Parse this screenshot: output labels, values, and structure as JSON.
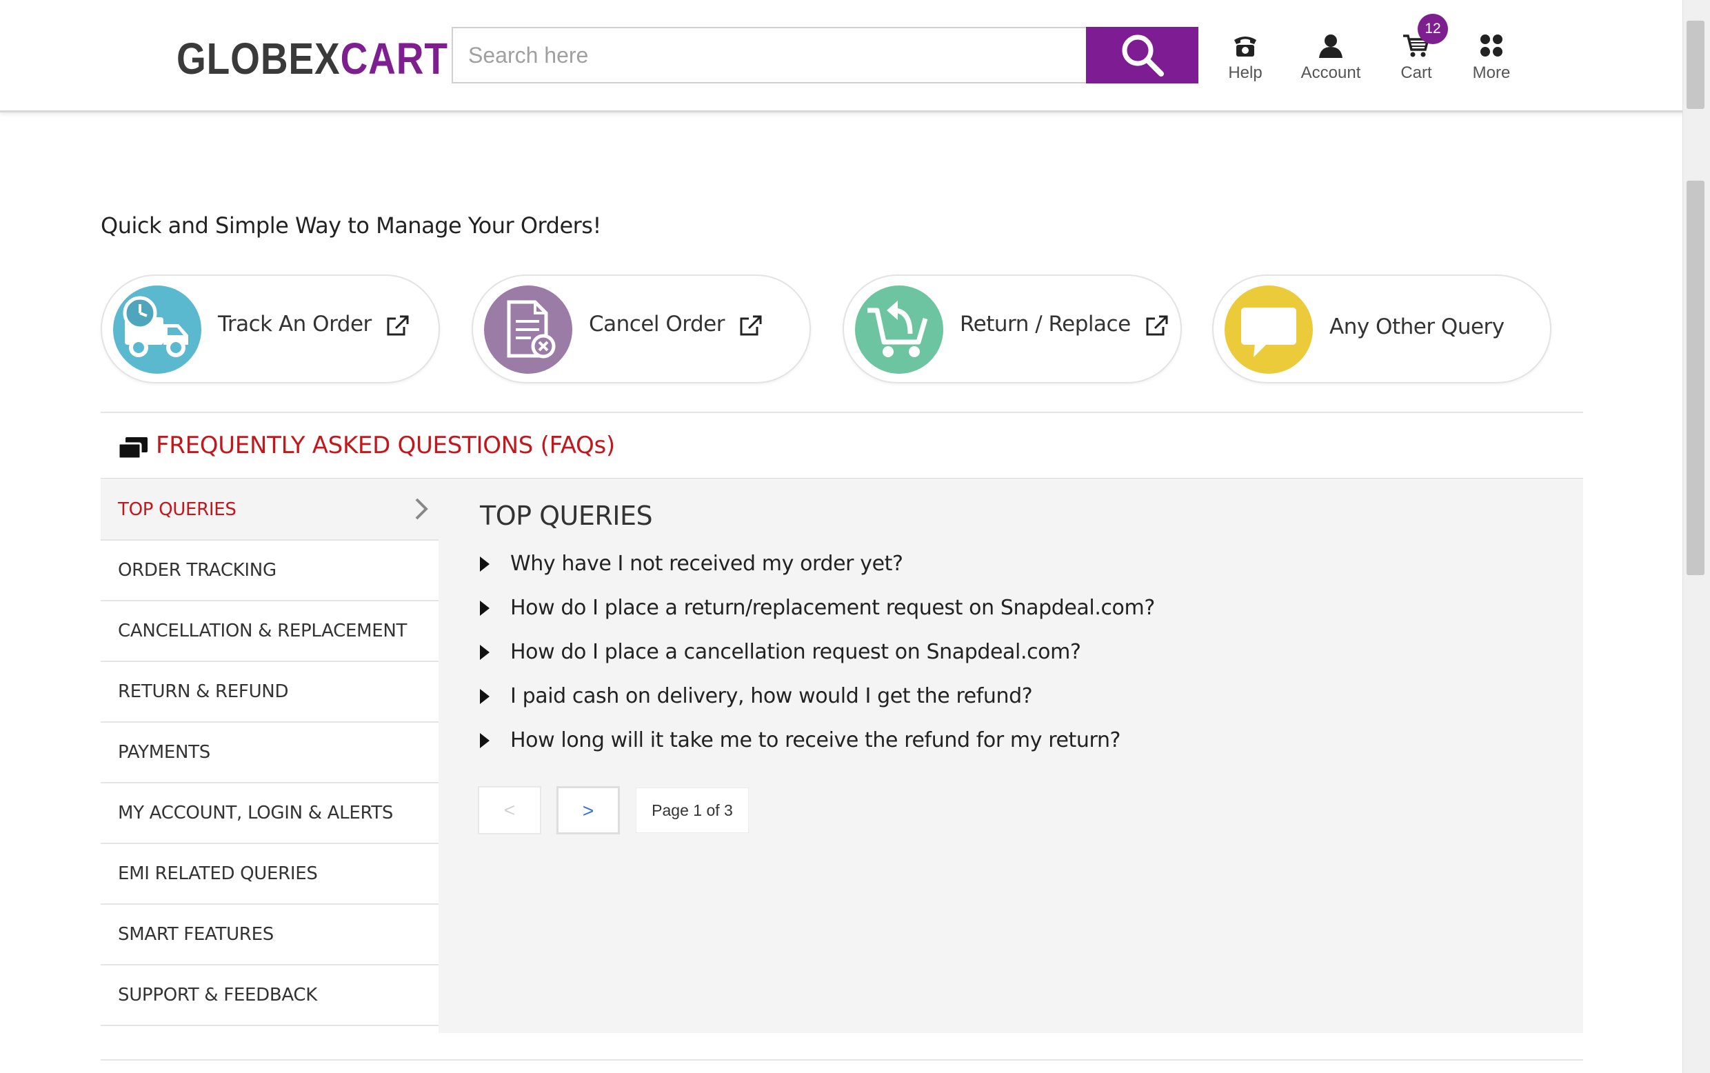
{
  "header": {
    "logo_part1": "GLOBEX",
    "logo_part2": "CART",
    "search_placeholder": "Search here",
    "nav": {
      "help": "Help",
      "account": "Account",
      "cart": "Cart",
      "cart_count": "12",
      "more": "More"
    }
  },
  "main": {
    "tagline": "Quick and Simple Way to Manage Your Orders!",
    "cards": [
      {
        "label": "Track An Order",
        "icon": "truck-clock-icon",
        "color": "#5bb9cf"
      },
      {
        "label": "Cancel Order",
        "icon": "document-cancel-icon",
        "color": "#9b7ca6"
      },
      {
        "label": "Return / Replace",
        "icon": "cart-return-icon",
        "color": "#6cc4a0"
      },
      {
        "label": "Any Other Query",
        "icon": "speech-bubble-icon",
        "color": "#eccb3a"
      }
    ]
  },
  "faq": {
    "title": "FREQUENTLY ASKED QUESTIONS (FAQs)",
    "categories": [
      "TOP QUERIES",
      "ORDER TRACKING",
      "CANCELLATION & REPLACEMENT",
      "RETURN & REFUND",
      "PAYMENTS",
      "MY ACCOUNT, LOGIN & ALERTS",
      "EMI RELATED QUERIES",
      "SMART FEATURES",
      "SUPPORT & FEEDBACK"
    ],
    "active_category": "TOP QUERIES",
    "section_title": "TOP QUERIES",
    "questions": [
      "Why have I not received my order yet?",
      "How do I place a return/replacement request on Snapdeal.com?",
      "How do I place a cancellation request on Snapdeal.com?",
      "I paid cash on delivery, how would I get the refund?",
      "How long will it take me to receive the refund for my return?"
    ],
    "pagination": {
      "prev": "<",
      "next": ">",
      "info": "Page 1 of 3"
    }
  },
  "colors": {
    "brand": "#7d1f8f",
    "accent_red": "#c2171d"
  }
}
